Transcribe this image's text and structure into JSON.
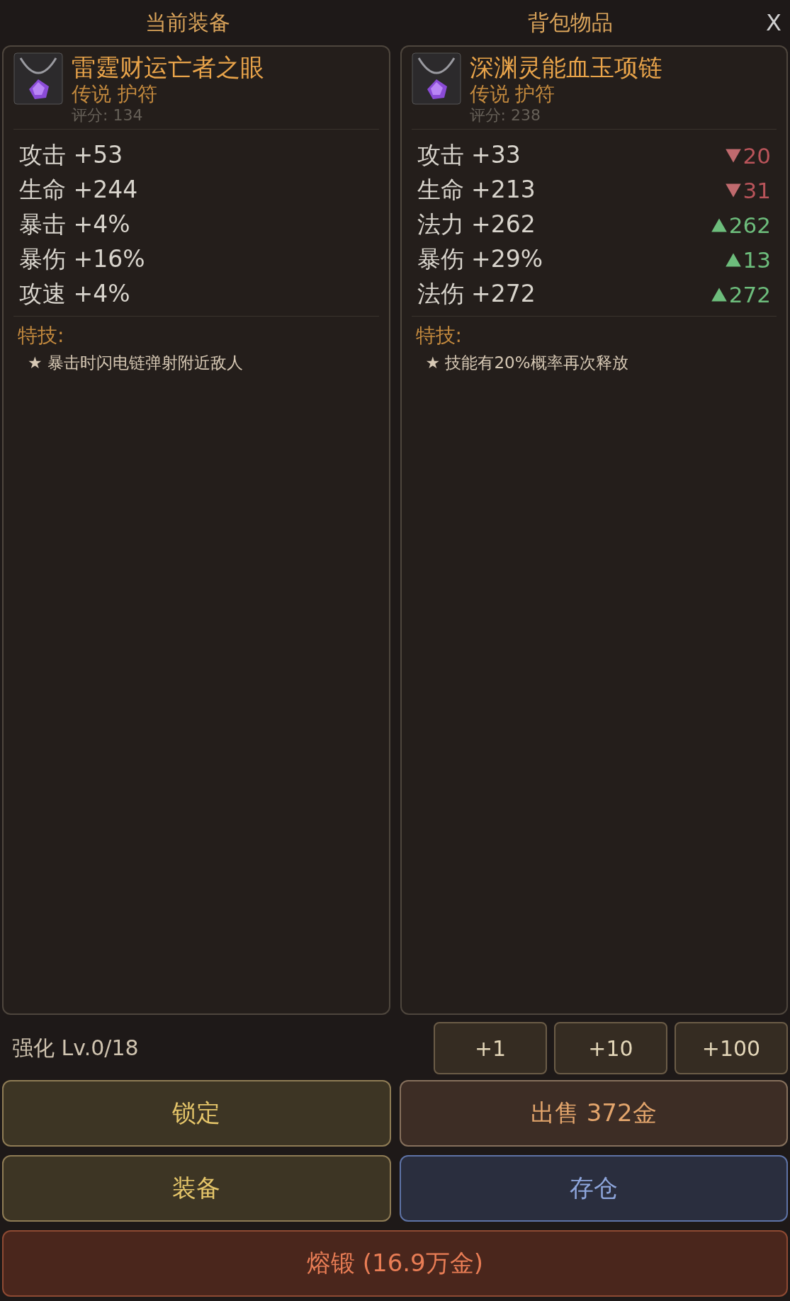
{
  "header": {
    "left_title": "当前装备",
    "right_title": "背包物品",
    "close": "X"
  },
  "panels": [
    {
      "name": "雷霆财运亡者之眼",
      "rarity": "传说 护符",
      "score": "评分: 134",
      "stats": [
        {
          "text": "攻击 +53"
        },
        {
          "text": "生命 +244"
        },
        {
          "text": "暴击 +4%"
        },
        {
          "text": "暴伤 +16%"
        },
        {
          "text": "攻速 +4%"
        }
      ],
      "skill_label": "特技:",
      "skills": [
        "★ 暴击时闪电链弹射附近敌人"
      ]
    },
    {
      "name": "深渊灵能血玉项链",
      "rarity": "传说 护符",
      "score": "评分: 238",
      "stats": [
        {
          "text": "攻击 +33",
          "delta": {
            "better": false,
            "value": "20"
          }
        },
        {
          "text": "生命 +213",
          "delta": {
            "better": false,
            "value": "31"
          }
        },
        {
          "text": "法力 +262",
          "delta": {
            "better": true,
            "value": "262"
          }
        },
        {
          "text": "暴伤 +29%",
          "delta": {
            "better": true,
            "value": "13"
          }
        },
        {
          "text": "法伤 +272",
          "delta": {
            "better": true,
            "value": "272"
          }
        }
      ],
      "skill_label": "特技:",
      "skills": [
        "★ 技能有20%概率再次释放"
      ]
    }
  ],
  "enhance": {
    "label": "强化 Lv.0/18",
    "steps": [
      "+1",
      "+10",
      "+100"
    ]
  },
  "buttons": [
    {
      "label": "锁定",
      "kind": "gold"
    },
    {
      "label": "出售 372金",
      "kind": "brown"
    },
    {
      "label": "装备",
      "kind": "gold"
    },
    {
      "label": "存仓",
      "kind": "blue"
    },
    {
      "label": "熔锻 (16.9万金)",
      "kind": "red"
    }
  ]
}
